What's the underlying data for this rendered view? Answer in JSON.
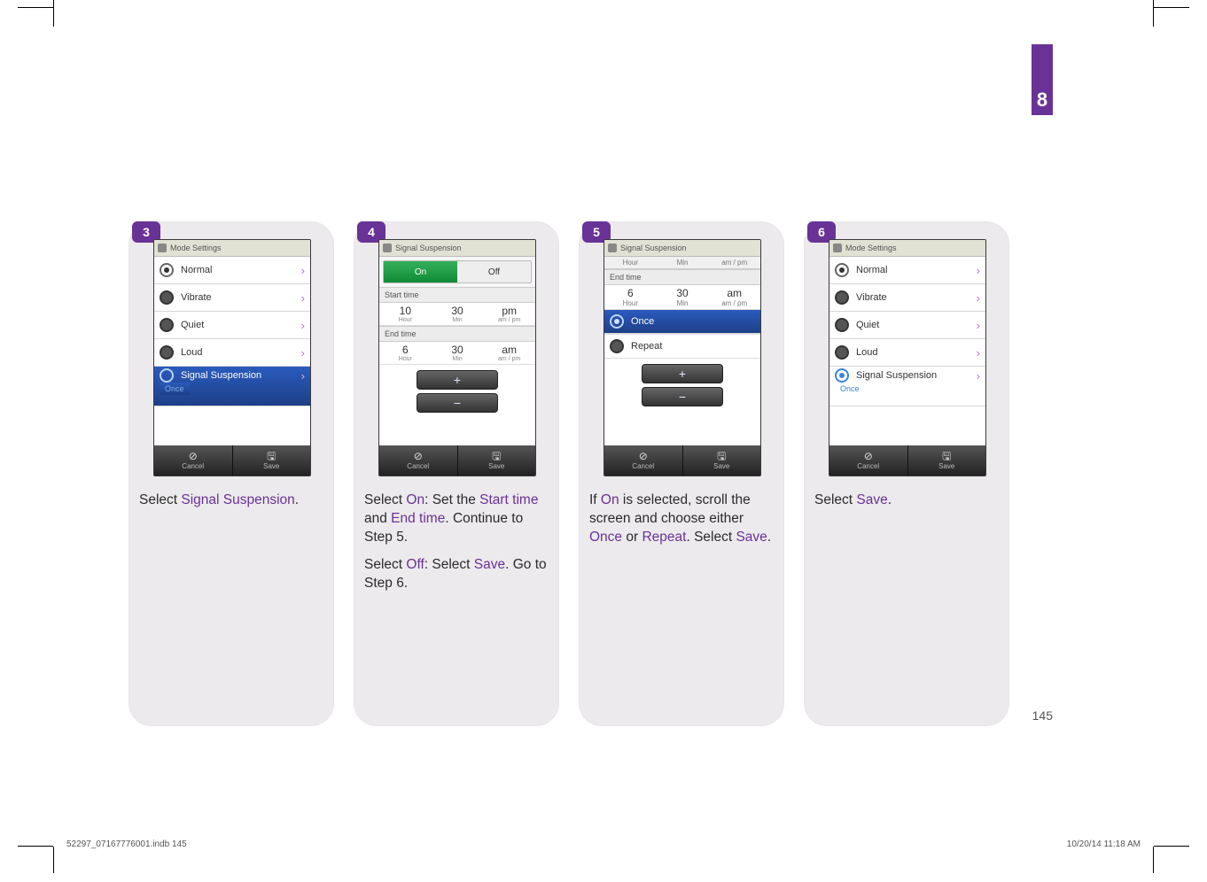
{
  "chapter": "8",
  "page_number": "145",
  "footer": {
    "file": "52297_07167776001.indb   145",
    "datetime": "10/20/14   11:18 AM"
  },
  "steps": {
    "s3": {
      "num": "3",
      "header": "Mode Settings",
      "items": [
        "Normal",
        "Vibrate",
        "Quiet",
        "Loud"
      ],
      "suspension_label": "Signal Suspension",
      "suspension_sub": "Once",
      "cancel": "Cancel",
      "save": "Save",
      "caption_a": "Select ",
      "caption_b": "Signal Suspension",
      "caption_c": "."
    },
    "s4": {
      "num": "4",
      "header": "Signal Suspension",
      "on": "On",
      "off": "Off",
      "start_label": "Start time",
      "start": {
        "hour": "10",
        "min": "30",
        "ampm": "pm",
        "hour_l": "Hour",
        "min_l": "Min",
        "ampm_l": "am / pm"
      },
      "end_label": "End time",
      "end": {
        "hour": "6",
        "min": "30",
        "ampm": "am",
        "hour_l": "Hour",
        "min_l": "Min",
        "ampm_l": "am / pm"
      },
      "cancel": "Cancel",
      "save": "Save",
      "p1_a": "Select ",
      "p1_b": "On",
      "p1_c": ": Set the ",
      "p1_d": "Start time",
      "p1_e": " and ",
      "p1_f": "End time",
      "p1_g": ". Continue to Step 5.",
      "p2_a": "Select ",
      "p2_b": "Off",
      "p2_c": ": Select ",
      "p2_d": "Save",
      "p2_e": ". Go to Step 6."
    },
    "s5": {
      "num": "5",
      "header": "Signal Suspension",
      "head": {
        "hour": "Hour",
        "min": "Min",
        "ampm": "am / pm"
      },
      "end_label": "End time",
      "end": {
        "hour": "6",
        "min": "30",
        "ampm": "am",
        "hour_l": "Hour",
        "min_l": "Min",
        "ampm_l": "am / pm"
      },
      "opt_once": "Once",
      "opt_repeat": "Repeat",
      "cancel": "Cancel",
      "save": "Save",
      "p_a": "If ",
      "p_b": "On",
      "p_c": " is selected, scroll the screen and choose either ",
      "p_d": "Once",
      "p_e": " or ",
      "p_f": "Repeat",
      "p_g": ". Select ",
      "p_h": "Save",
      "p_i": "."
    },
    "s6": {
      "num": "6",
      "header": "Mode Settings",
      "items": [
        "Normal",
        "Vibrate",
        "Quiet",
        "Loud"
      ],
      "suspension_label": "Signal Suspension",
      "suspension_sub": "Once",
      "cancel": "Cancel",
      "save": "Save",
      "caption_a": "Select ",
      "caption_b": "Save",
      "caption_c": "."
    }
  }
}
